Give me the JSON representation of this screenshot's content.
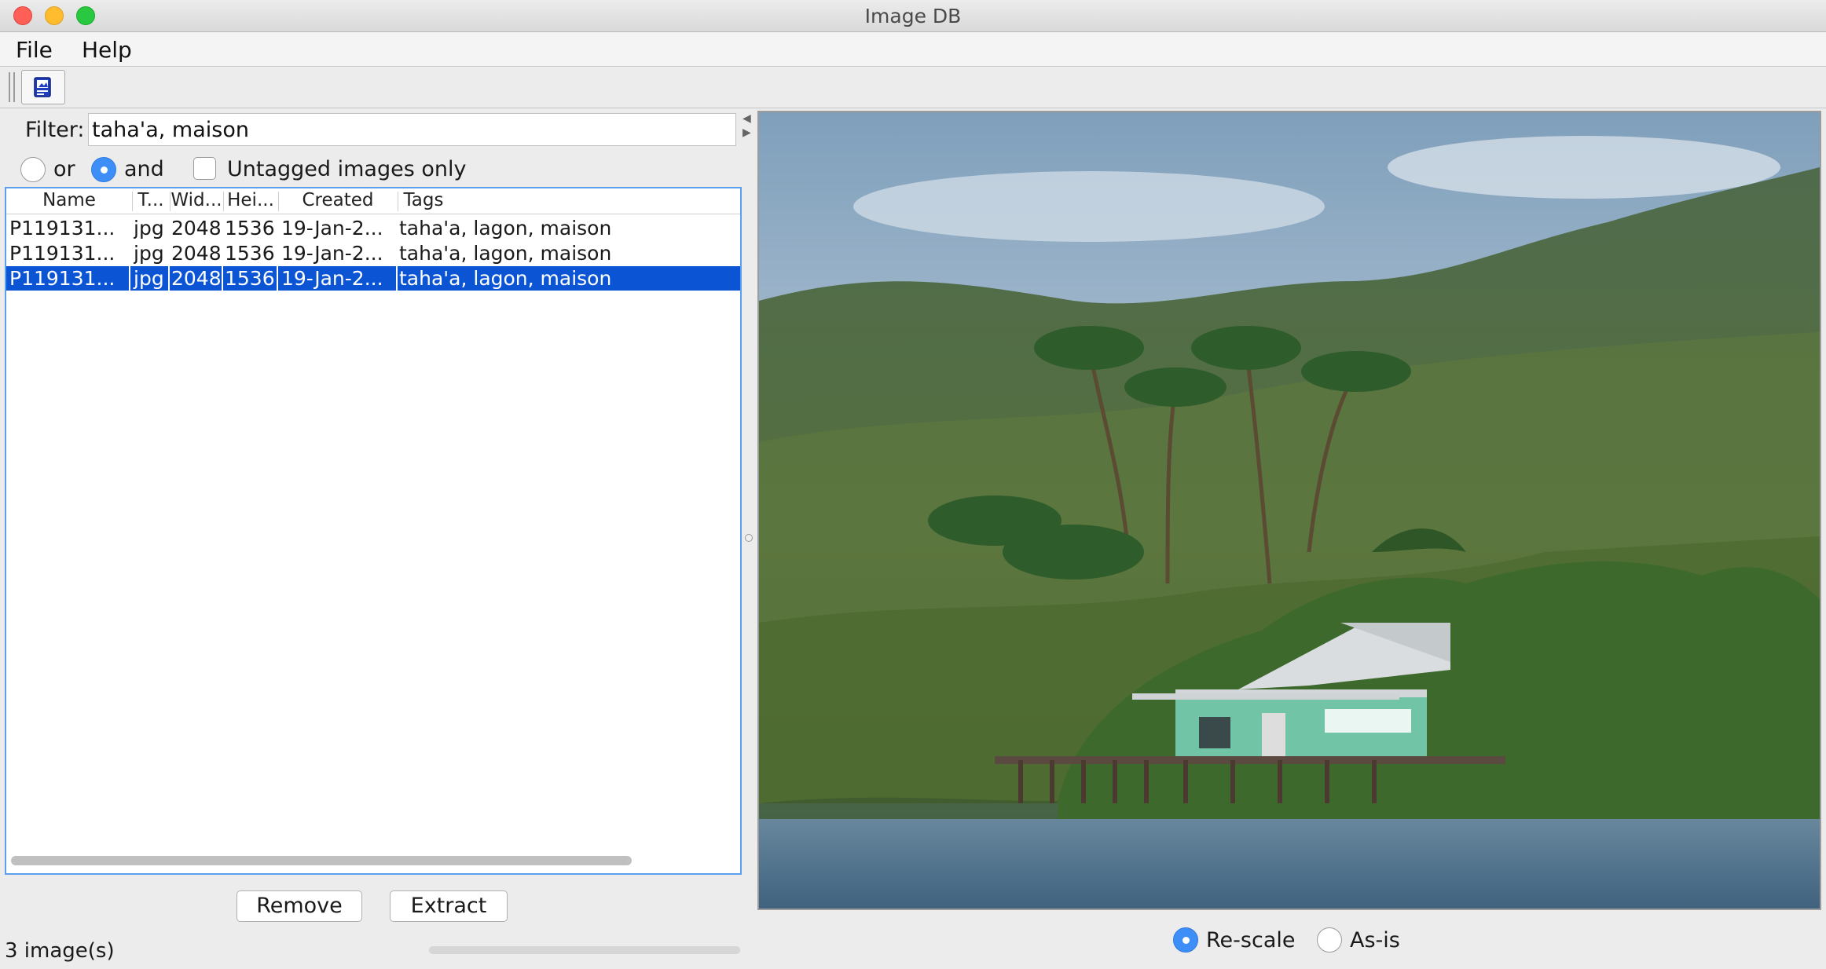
{
  "window": {
    "title": "Image DB"
  },
  "menu": {
    "file": "File",
    "help": "Help"
  },
  "filter": {
    "label": "Filter:",
    "value": "taha'a, maison"
  },
  "match_mode": {
    "or_label": "or",
    "and_label": "and",
    "selected": "and"
  },
  "untagged_only": {
    "label": "Untagged images only",
    "checked": false
  },
  "table": {
    "columns": [
      "Name",
      "T...",
      "Wid...",
      "Hei...",
      "Created",
      "Tags"
    ],
    "rows": [
      {
        "name": "P119131...",
        "type": "jpg",
        "width": "2048",
        "height": "1536",
        "created": "19-Jan-2...",
        "tags": "taha'a, lagon, maison"
      },
      {
        "name": "P119131...",
        "type": "jpg",
        "width": "2048",
        "height": "1536",
        "created": "19-Jan-2...",
        "tags": "taha'a, lagon, maison"
      },
      {
        "name": "P119131...",
        "type": "jpg",
        "width": "2048",
        "height": "1536",
        "created": "19-Jan-2...",
        "tags": "taha'a, lagon, maison"
      }
    ],
    "selected_row": 2
  },
  "buttons": {
    "remove": "Remove",
    "extract": "Extract"
  },
  "status": {
    "count_text": "3 image(s)"
  },
  "view_mode": {
    "rescale_label": "Re-scale",
    "asis_label": "As-is",
    "selected": "Re-scale"
  },
  "icons": {
    "toolbar": "image-db-icon"
  },
  "colors": {
    "selection": "#0b55d5",
    "accent": "#3d8ef7"
  }
}
